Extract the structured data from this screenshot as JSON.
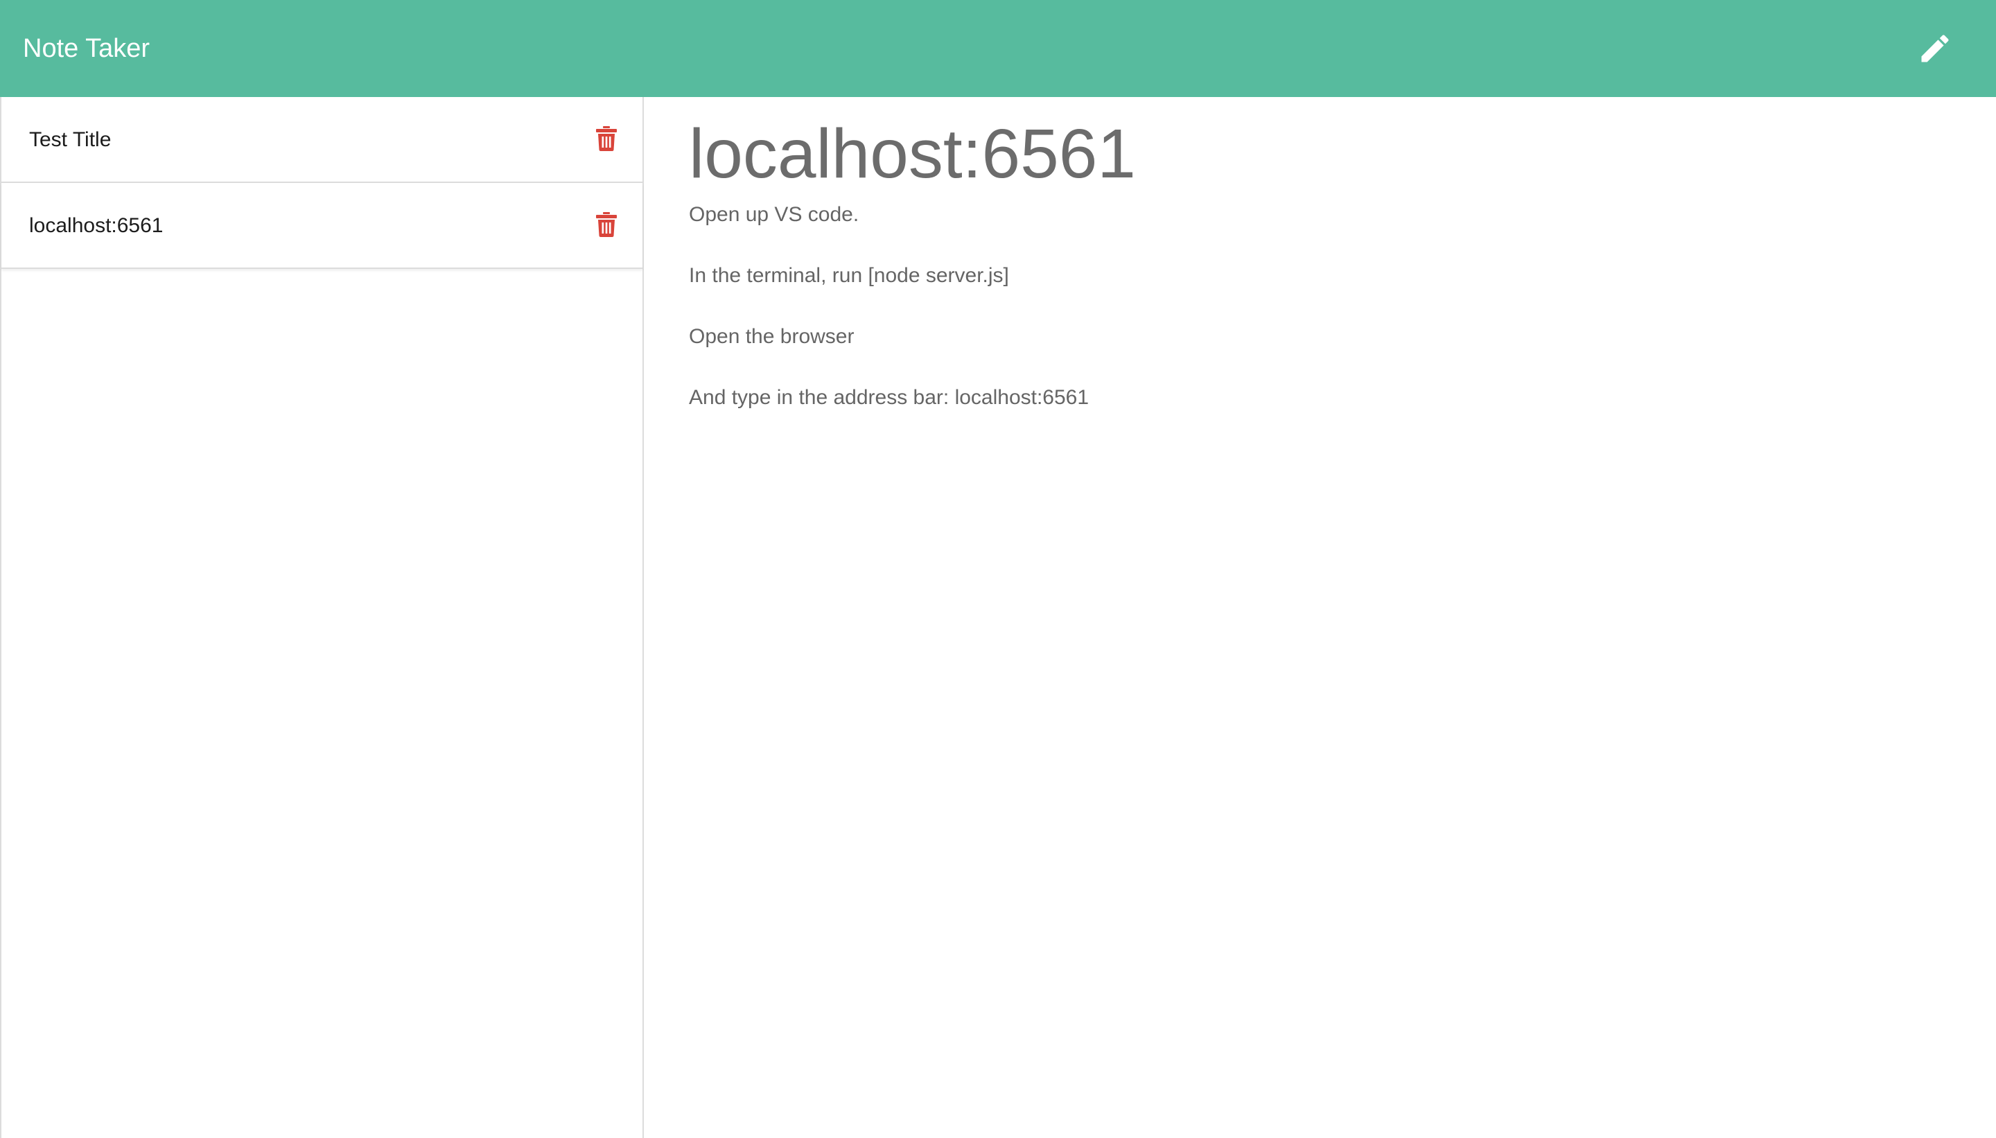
{
  "app": {
    "brand": "Note Taker",
    "accent_color": "#57bb9e",
    "delete_color": "#d9443a",
    "new_note_icon": "pencil-icon",
    "delete_icon": "trash-icon"
  },
  "sidebar": {
    "notes": [
      {
        "title": "Test Title"
      },
      {
        "title": "localhost:6561"
      }
    ]
  },
  "active_note": {
    "title": "localhost:6561",
    "lines": [
      "Open up VS code.",
      "In the terminal, run [node server.js]",
      "Open the browser",
      "And type in the address bar: localhost:6561"
    ]
  }
}
